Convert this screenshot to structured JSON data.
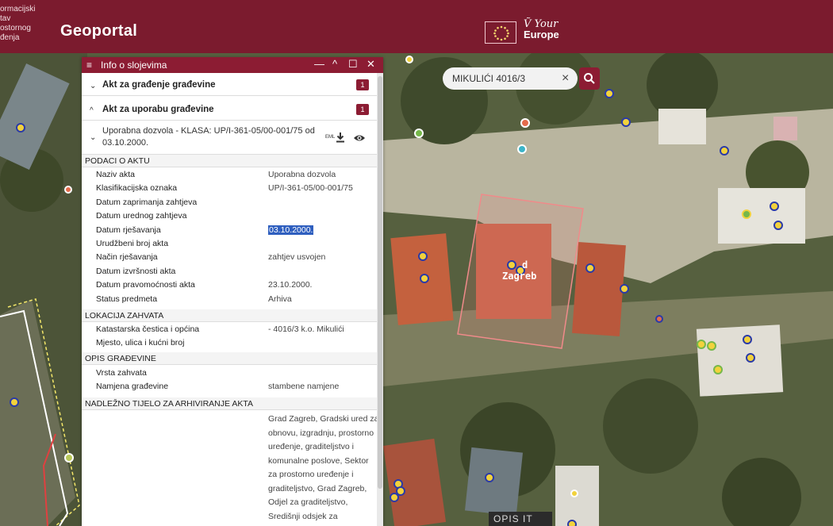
{
  "header": {
    "org_logo_text": "ormacijski\ntav\nostornog\nđenja",
    "app_title": "Geoportal",
    "partner_line1": "Ṽ Your",
    "partner_line2": "Europe"
  },
  "search": {
    "value": "MIKULIĆI 4016/3",
    "clear_label": "×"
  },
  "map": {
    "parcel_label_line1": "d",
    "parcel_label_line2": "Zagreb",
    "footer_badge": "OPIS IT"
  },
  "panel": {
    "title": "Info o slojevima",
    "menu_icon": "≡",
    "controls": {
      "minimize": "—",
      "collapse": "^",
      "maximize": "☐",
      "close": "✕"
    },
    "sections": [
      {
        "label": "Akt za građenje građevine",
        "badge": "1",
        "chevron": "⌄"
      },
      {
        "label": "Akt za uporabu građevine",
        "badge": "1",
        "chevron": "^"
      }
    ],
    "document": {
      "chevron": "⌄",
      "label": "Uporabna dozvola - KLASA: UP/I-361-05/00-001/75 od 03.10.2000.",
      "eml_label": "EML"
    },
    "groups": {
      "podaci": "PODACI O AKTU",
      "lokacija": "LOKACIJA ZAHVATA",
      "opis": "OPIS GRAĐEVINE",
      "nadlezno": "NADLEŽNO TIJELO ZA ARHIVIRANJE AKTA"
    },
    "podaci_rows": [
      {
        "label": "Naziv akta",
        "value": "Uporabna dozvola"
      },
      {
        "label": "Klasifikacijska oznaka",
        "value": "UP/I-361-05/00-001/75"
      },
      {
        "label": "Datum zaprimanja zahtjeva",
        "value": ""
      },
      {
        "label": "Datum urednog zahtjeva",
        "value": ""
      },
      {
        "label": "Datum rješavanja",
        "value": "03.10.2000."
      },
      {
        "label": "Urudžbeni broj akta",
        "value": ""
      },
      {
        "label": "Način rješavanja",
        "value": "zahtjev usvojen"
      },
      {
        "label": "Datum izvršnosti akta",
        "value": ""
      },
      {
        "label": "Datum pravomoćnosti akta",
        "value": "23.10.2000."
      },
      {
        "label": "Status predmeta",
        "value": "Arhiva"
      }
    ],
    "lokacija_rows": [
      {
        "label": "Katastarska čestica i općina",
        "value": "- 4016/3 k.o. Mikulići"
      },
      {
        "label": "Mjesto, ulica i kućni broj",
        "value": ""
      }
    ],
    "opis_rows": [
      {
        "label": "Vrsta zahvata",
        "value": ""
      },
      {
        "label": "Namjena građevine",
        "value": "stambene namjene"
      }
    ],
    "nadlezno_value": "Grad Zagreb, Gradski ured za obnovu, izgradnju, prostorno uređenje, graditeljstvo i komunalne poslove, Sektor za prostorno uređenje i graditeljstvo, Grad Zagreb, Odjel za graditeljstvo, Središnji odsjek za"
  },
  "colors": {
    "brand": "#7b1b2e",
    "panel_header": "#8c1c33",
    "selection": "#2f5fbf"
  }
}
